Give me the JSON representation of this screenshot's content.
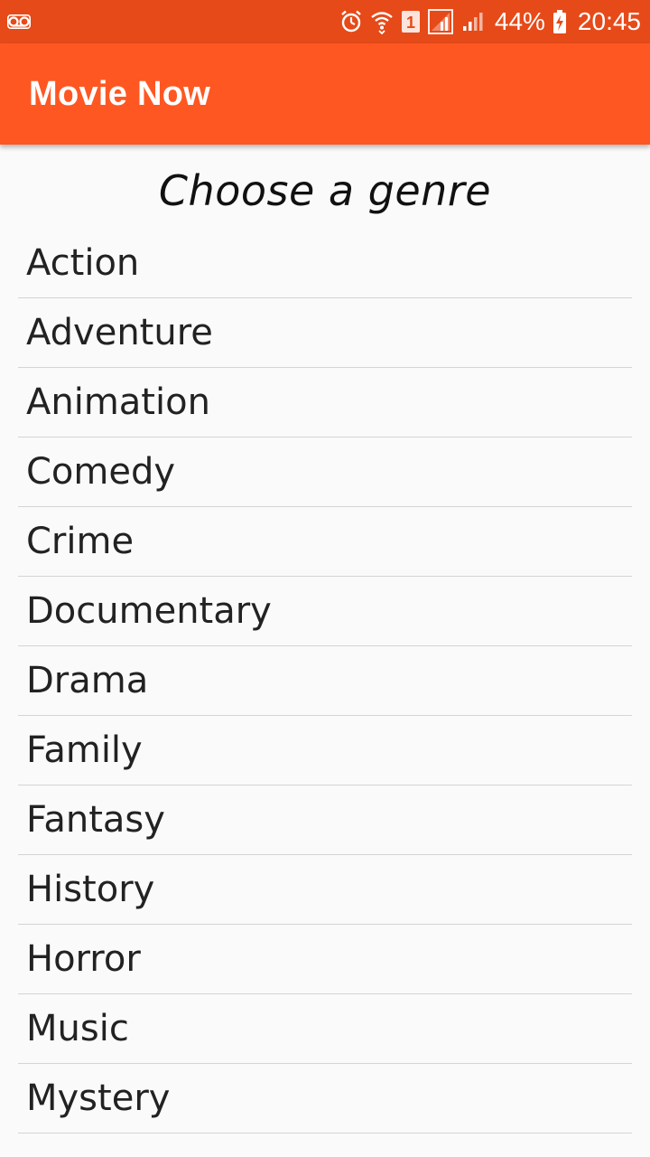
{
  "status_bar": {
    "battery_percent": "44%",
    "time": "20:45",
    "sim_number": "1",
    "icons": [
      "voicemail-icon",
      "alarm-icon",
      "wifi-icon",
      "sim-icon",
      "signal-icon",
      "signal-icon",
      "battery-charging-icon"
    ],
    "background_color": "#e64a19"
  },
  "app_bar": {
    "title": "Movie Now",
    "background_color": "#ff5722"
  },
  "main": {
    "heading": "Choose a genre",
    "genres": [
      "Action",
      "Adventure",
      "Animation",
      "Comedy",
      "Crime",
      "Documentary",
      "Drama",
      "Family",
      "Fantasy",
      "History",
      "Horror",
      "Music",
      "Mystery"
    ]
  }
}
